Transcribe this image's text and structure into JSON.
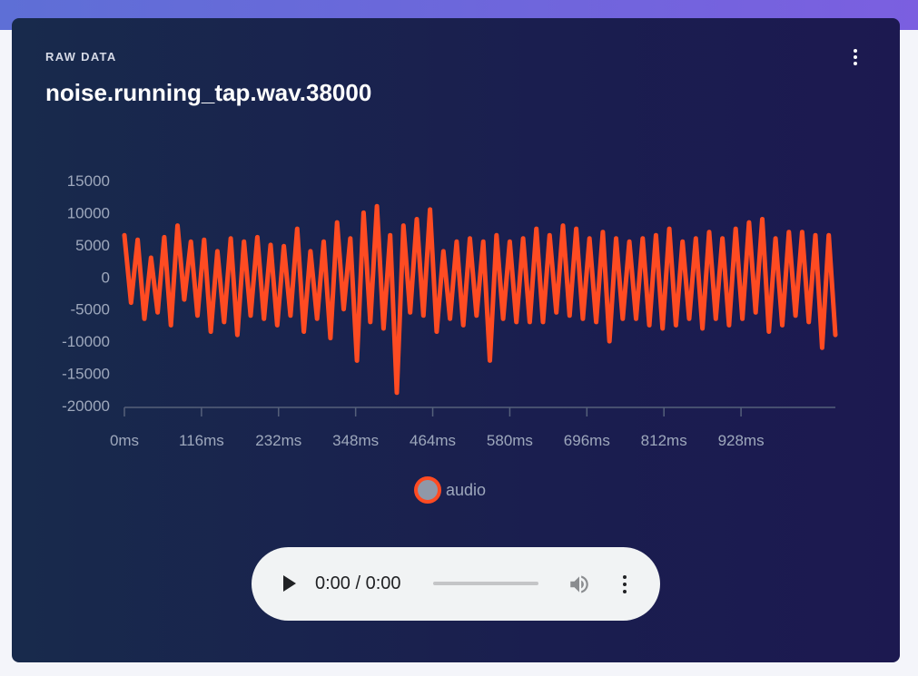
{
  "card": {
    "eyebrow": "RAW DATA",
    "title": "noise.running_tap.wav.38000"
  },
  "audio_player": {
    "time": "0:00 / 0:00"
  },
  "colors": {
    "series": "#ff4b22",
    "legend_fill": "#8f98a8",
    "axis_text": "#9ea8bc"
  },
  "icons": [
    "kebab-menu-icon",
    "play-icon",
    "volume-icon",
    "player-menu-icon"
  ],
  "chart_data": {
    "type": "line",
    "title": "",
    "xlabel": "",
    "ylabel": "",
    "ylim": [
      -20000,
      15000
    ],
    "xlim_ms": [
      0,
      1070
    ],
    "y_ticks": [
      15000,
      10000,
      5000,
      0,
      -5000,
      -10000,
      -15000,
      -20000
    ],
    "y_tick_labels": [
      "15000",
      "10000",
      "5000",
      "0",
      "-5000",
      "-10000",
      "-15000",
      "-20000"
    ],
    "x_ticks": [
      0,
      116,
      232,
      348,
      464,
      580,
      696,
      812,
      928
    ],
    "x_tick_labels": [
      "0ms",
      "116ms",
      "232ms",
      "348ms",
      "464ms",
      "580ms",
      "696ms",
      "812ms",
      "928ms"
    ],
    "legend_position": "bottom",
    "series": [
      {
        "name": "audio",
        "x_ms": [
          0,
          10,
          20,
          30,
          40,
          50,
          60,
          70,
          80,
          90,
          100,
          110,
          120,
          130,
          140,
          150,
          160,
          170,
          180,
          190,
          200,
          210,
          220,
          230,
          240,
          250,
          260,
          270,
          280,
          290,
          300,
          310,
          320,
          330,
          340,
          350,
          360,
          370,
          380,
          390,
          400,
          410,
          420,
          430,
          440,
          450,
          460,
          470,
          480,
          490,
          500,
          510,
          520,
          530,
          540,
          550,
          560,
          570,
          580,
          590,
          600,
          610,
          620,
          630,
          640,
          650,
          660,
          670,
          680,
          690,
          700,
          710,
          720,
          730,
          740,
          750,
          760,
          770,
          780,
          790,
          800,
          810,
          820,
          830,
          840,
          850,
          860,
          870,
          880,
          890,
          900,
          910,
          920,
          930,
          940,
          950,
          960,
          970,
          980,
          990,
          1000,
          1010,
          1020,
          1030,
          1040,
          1050,
          1060,
          1070
        ],
        "values": [
          6500,
          -4000,
          5800,
          -6500,
          3000,
          -5500,
          6200,
          -7500,
          8000,
          -3500,
          5500,
          -6000,
          5800,
          -8500,
          4000,
          -7000,
          6000,
          -9000,
          5500,
          -6000,
          6200,
          -6500,
          5000,
          -7500,
          4800,
          -6000,
          7500,
          -8500,
          4000,
          -6500,
          5500,
          -9500,
          8500,
          -5000,
          6000,
          -13000,
          10000,
          -7000,
          11000,
          -8000,
          6500,
          -18000,
          8000,
          -5500,
          9000,
          -6000,
          10500,
          -8500,
          4000,
          -6500,
          5500,
          -7500,
          6000,
          -6000,
          5500,
          -13000,
          6500,
          -6500,
          5500,
          -7000,
          6000,
          -7000,
          7500,
          -7000,
          6500,
          -5500,
          8000,
          -6000,
          7500,
          -6500,
          6000,
          -7000,
          7000,
          -10000,
          6000,
          -6500,
          5500,
          -6500,
          6000,
          -7500,
          6500,
          -8000,
          7500,
          -7500,
          5500,
          -6500,
          6000,
          -8000,
          7000,
          -6500,
          6000,
          -7500,
          7500,
          -6500,
          8500,
          -5500,
          9000,
          -8500,
          6000,
          -7500,
          7000,
          -6000,
          7000,
          -7000,
          6500,
          -11000,
          6500,
          -9000
        ]
      }
    ]
  }
}
